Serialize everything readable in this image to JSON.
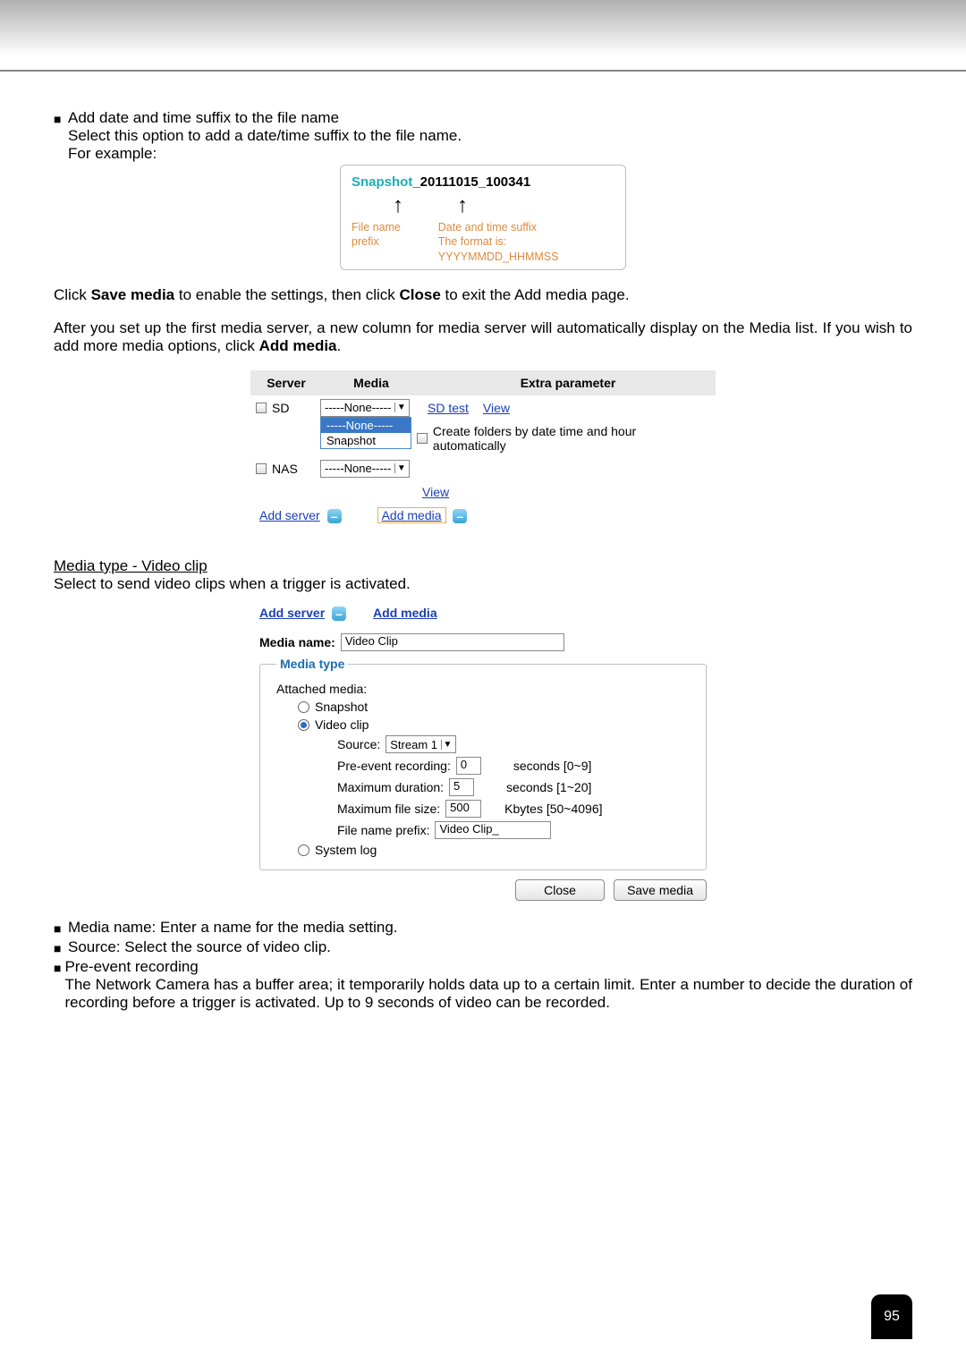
{
  "intro": {
    "bullet_title": "Add date and time suffix to the file name",
    "line1": "Select this option to add a date/time suffix to the file name.",
    "line2": "For example:"
  },
  "example": {
    "prefix_word": "Snapshot",
    "suffix_word": "_20111015_100341",
    "label_prefix": "File name prefix",
    "label_suffix_1": "Date and time suffix",
    "label_suffix_2": "The format is: YYYYMMDD_HHMMSS"
  },
  "para1": {
    "p1a": "Click ",
    "p1b": "Save media",
    "p1c": " to enable the settings, then click ",
    "p1d": "Close",
    "p1e": " to exit the Add media page."
  },
  "para2": {
    "p2a": "After you set up the first media server, a new column for media server will automatically display on the Media list. If you wish to add more media options, click ",
    "p2b": "Add media",
    "p2c": "."
  },
  "media_list": {
    "h_server": "Server",
    "h_media": "Media",
    "h_extra": "Extra parameter",
    "row_sd": "SD",
    "row_nas": "NAS",
    "sel_none": "-----None-----",
    "opt_none": "-----None-----",
    "opt_snapshot": "Snapshot",
    "link_sdtest": "SD test",
    "link_view": "View",
    "create_folders": "Create folders by date time and hour automatically",
    "add_server": "Add server",
    "add_media": "Add media"
  },
  "section_title": "Media type - Video clip",
  "section_sub": "Select to send video clips when a trigger is activated.",
  "form": {
    "media_name_label": "Media name:",
    "media_name_value": "Video Clip",
    "legend": "Media type",
    "attached_label": "Attached media:",
    "radio_snapshot": "Snapshot",
    "radio_videoclip": "Video clip",
    "radio_systemlog": "System log",
    "source_label": "Source:",
    "source_value": "Stream 1",
    "pre_label": "Pre-event recording:",
    "pre_value": "0",
    "pre_hint": "seconds [0~9]",
    "dur_label": "Maximum duration:",
    "dur_value": "5",
    "dur_hint": "seconds [1~20]",
    "size_label": "Maximum file size:",
    "size_value": "500",
    "size_hint": "Kbytes [50~4096]",
    "prefix_label": "File name prefix:",
    "prefix_value": "Video Clip_",
    "btn_close": "Close",
    "btn_save": "Save media"
  },
  "footer_bullets": {
    "b1": "Media name: Enter a name for the media setting.",
    "b2": "Source: Select the source of video clip.",
    "b3": "Pre-event recording",
    "b3_body": "The Network Camera has a buffer area; it temporarily holds data up to a certain limit. Enter a number to decide the duration of recording before a trigger is activated. Up to 9 seconds of video can be recorded."
  },
  "page_number": "95"
}
